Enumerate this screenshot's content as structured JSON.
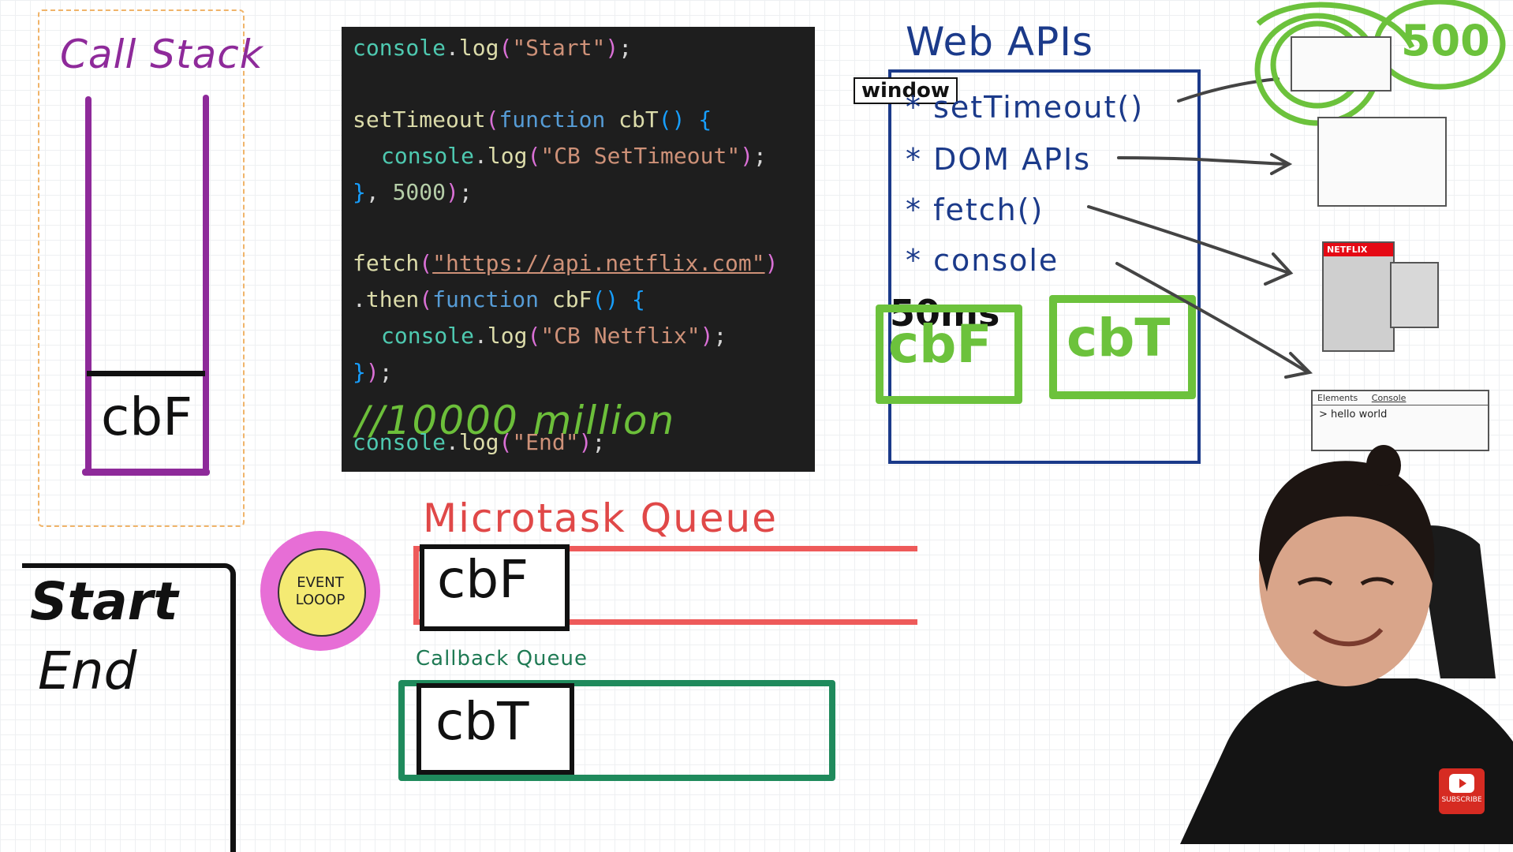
{
  "call_stack": {
    "title": "Call Stack",
    "items": [
      "cbF"
    ]
  },
  "code": {
    "line1": {
      "obj": "console",
      "fn": "log",
      "str": "\"Start\""
    },
    "line2": {
      "fn": "setTimeout",
      "kw": "function",
      "name": "cbT"
    },
    "line3": {
      "obj": "console",
      "fn": "log",
      "str": "\"CB SetTimeout\""
    },
    "line4": {
      "num": "5000"
    },
    "line5": {
      "fn": "fetch",
      "url": "\"https://api.netflix.com\""
    },
    "line6": {
      "fn": "then",
      "kw": "function",
      "name": "cbF"
    },
    "line7": {
      "obj": "console",
      "fn": "log",
      "str": "\"CB Netflix\""
    },
    "line9": {
      "obj": "console",
      "fn": "log",
      "str": "\"End\""
    },
    "annotation": "//10000 million"
  },
  "web_apis": {
    "title": "Web APIs",
    "window_label": "window",
    "items": [
      "* setTimeout()",
      "* DOM APIs",
      "* fetch()",
      "* console"
    ],
    "timer_label": "50ms",
    "pending": [
      "cbF",
      "cbT"
    ],
    "timer_badge": "500"
  },
  "sketches": {
    "netflix_label": "NETFLIX",
    "devtools_tabs": [
      "Elements",
      "Console"
    ],
    "devtools_output": "> hello world"
  },
  "microtask_queue": {
    "title": "Microtask Queue",
    "items": [
      "cbF"
    ]
  },
  "callback_queue": {
    "title": "Callback Queue",
    "items": [
      "cbT"
    ]
  },
  "event_loop": {
    "label_line1": "EVENT",
    "label_line2": "LOOOP"
  },
  "console_output": {
    "lines": [
      "Start",
      "End"
    ]
  },
  "youtube": {
    "subscribe_label": "SUBSCRIBE"
  },
  "colors": {
    "call_stack": "#8e2a9a",
    "web_apis": "#1b3a8a",
    "microtask": "#ee5a5a",
    "callback": "#1f8a5c",
    "pending_callbacks": "#6cc23c"
  }
}
